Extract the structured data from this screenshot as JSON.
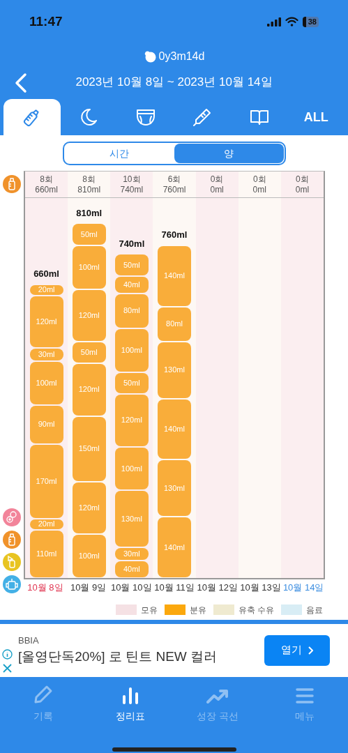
{
  "status_bar": {
    "time": "11:47",
    "battery": "38"
  },
  "header": {
    "baby_age": "0y3m14d",
    "date_range": "2023년 10월 8일 ~ 2023년 10월 14일"
  },
  "tabs": [
    {
      "kind": "bottle",
      "selected": true
    },
    {
      "kind": "moon",
      "selected": false
    },
    {
      "kind": "diaper",
      "selected": false
    },
    {
      "kind": "thermometer",
      "selected": false
    },
    {
      "kind": "book",
      "selected": false
    },
    {
      "kind": "text",
      "label": "ALL",
      "selected": false
    }
  ],
  "toggle": [
    {
      "label": "시간",
      "selected": false
    },
    {
      "label": "양",
      "selected": true
    }
  ],
  "days": [
    {
      "count": "8회",
      "amount": "660ml",
      "total": "660ml",
      "date": "10월 8일",
      "color": "#e0334f",
      "segments": [
        "20ml",
        "120ml",
        "30ml",
        "100ml",
        "90ml",
        "170ml",
        "20ml",
        "110ml"
      ]
    },
    {
      "count": "8회",
      "amount": "810ml",
      "total": "810ml",
      "date": "10월 9일",
      "color": "#333333",
      "segments": [
        "50ml",
        "100ml",
        "120ml",
        "50ml",
        "120ml",
        "150ml",
        "120ml",
        "100ml"
      ]
    },
    {
      "count": "10회",
      "amount": "740ml",
      "total": "740ml",
      "date": "10월 10일",
      "color": "#333333",
      "segments": [
        "50ml",
        "40ml",
        "80ml",
        "100ml",
        "50ml",
        "120ml",
        "100ml",
        "130ml",
        "30ml",
        "40ml"
      ]
    },
    {
      "count": "6회",
      "amount": "760ml",
      "total": "760ml",
      "date": "10월 11일",
      "color": "#333333",
      "segments": [
        "140ml",
        "80ml",
        "130ml",
        "140ml",
        "130ml",
        "140ml"
      ]
    },
    {
      "count": "0회",
      "amount": "0ml",
      "date": "10월 12일",
      "color": "#333333"
    },
    {
      "count": "0회",
      "amount": "0ml",
      "date": "10월 13일",
      "color": "#333333"
    },
    {
      "count": "0회",
      "amount": "0ml",
      "date": "10월 14일",
      "color": "#3b8de0"
    }
  ],
  "legend": [
    {
      "label": "모유",
      "color": "#f5e1e4"
    },
    {
      "label": "분유",
      "color": "#fba80e"
    },
    {
      "label": "유축 수유",
      "color": "#efead0"
    },
    {
      "label": "음료",
      "color": "#d8edf5"
    }
  ],
  "ad": {
    "brand": "BBIA",
    "headline": "[올영단독20%] 로 틴트 NEW 컬러",
    "button": "열기"
  },
  "bottom_nav": [
    {
      "kind": "pencil",
      "label": "기록",
      "selected": false
    },
    {
      "kind": "bars",
      "label": "정리표",
      "selected": true
    },
    {
      "kind": "trend",
      "label": "성장 곡선",
      "selected": false
    },
    {
      "kind": "menu",
      "label": "메뉴",
      "selected": false
    }
  ]
}
